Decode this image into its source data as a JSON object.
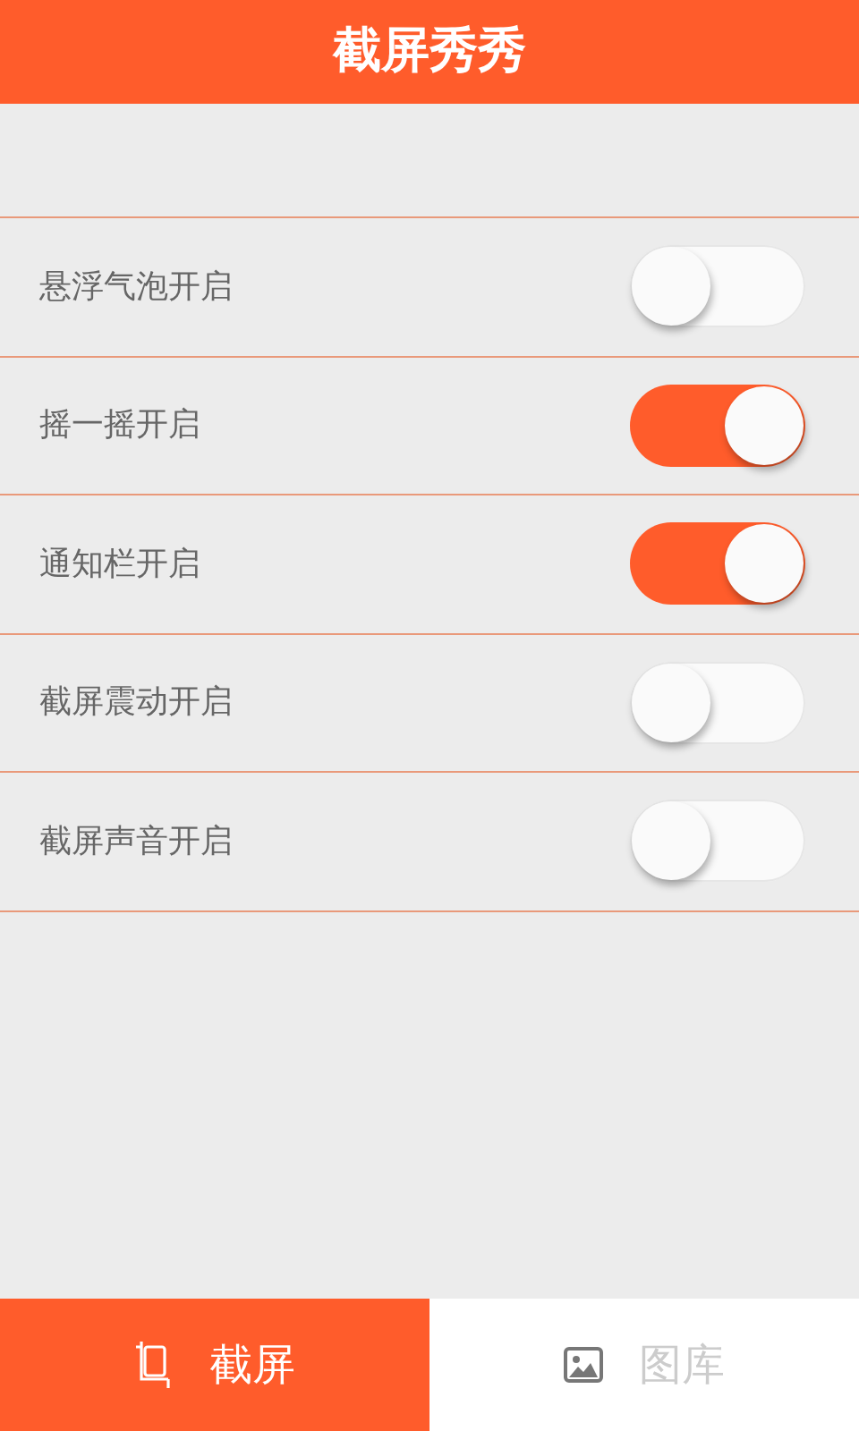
{
  "header": {
    "title": "截屏秀秀"
  },
  "settings": [
    {
      "label": "悬浮气泡开启",
      "on": false
    },
    {
      "label": "摇一摇开启",
      "on": true
    },
    {
      "label": "通知栏开启",
      "on": true
    },
    {
      "label": "截屏震动开启",
      "on": false
    },
    {
      "label": "截屏声音开启",
      "on": false
    }
  ],
  "tabs": [
    {
      "label": "截屏",
      "kind": "crop",
      "selected": true
    },
    {
      "label": "图库",
      "kind": "gallery",
      "selected": false
    }
  ]
}
